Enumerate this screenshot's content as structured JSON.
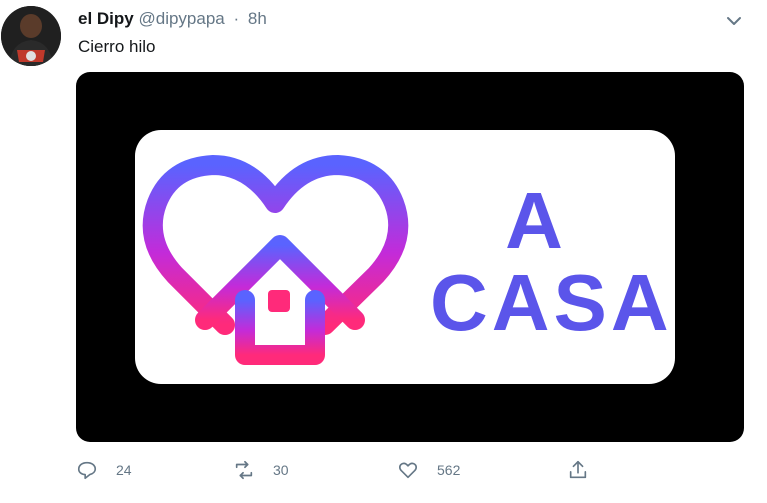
{
  "tweet": {
    "author_name": "el Dipy",
    "handle": "@dipypapa",
    "separator": "·",
    "time": "8h",
    "text": "Cierro hilo"
  },
  "media": {
    "sticker_line1": "A",
    "sticker_line2": "CASA"
  },
  "actions": {
    "replies": "24",
    "retweets": "30",
    "likes": "562"
  },
  "icons": [
    "avatar",
    "chevron-down-icon",
    "heart-house-logo",
    "reply-icon",
    "retweet-icon",
    "like-icon",
    "share-icon"
  ],
  "colors": {
    "text_primary": "#14171a",
    "text_secondary": "#657786",
    "sticker_text": "#5b55ea",
    "media_bg": "#000000"
  }
}
